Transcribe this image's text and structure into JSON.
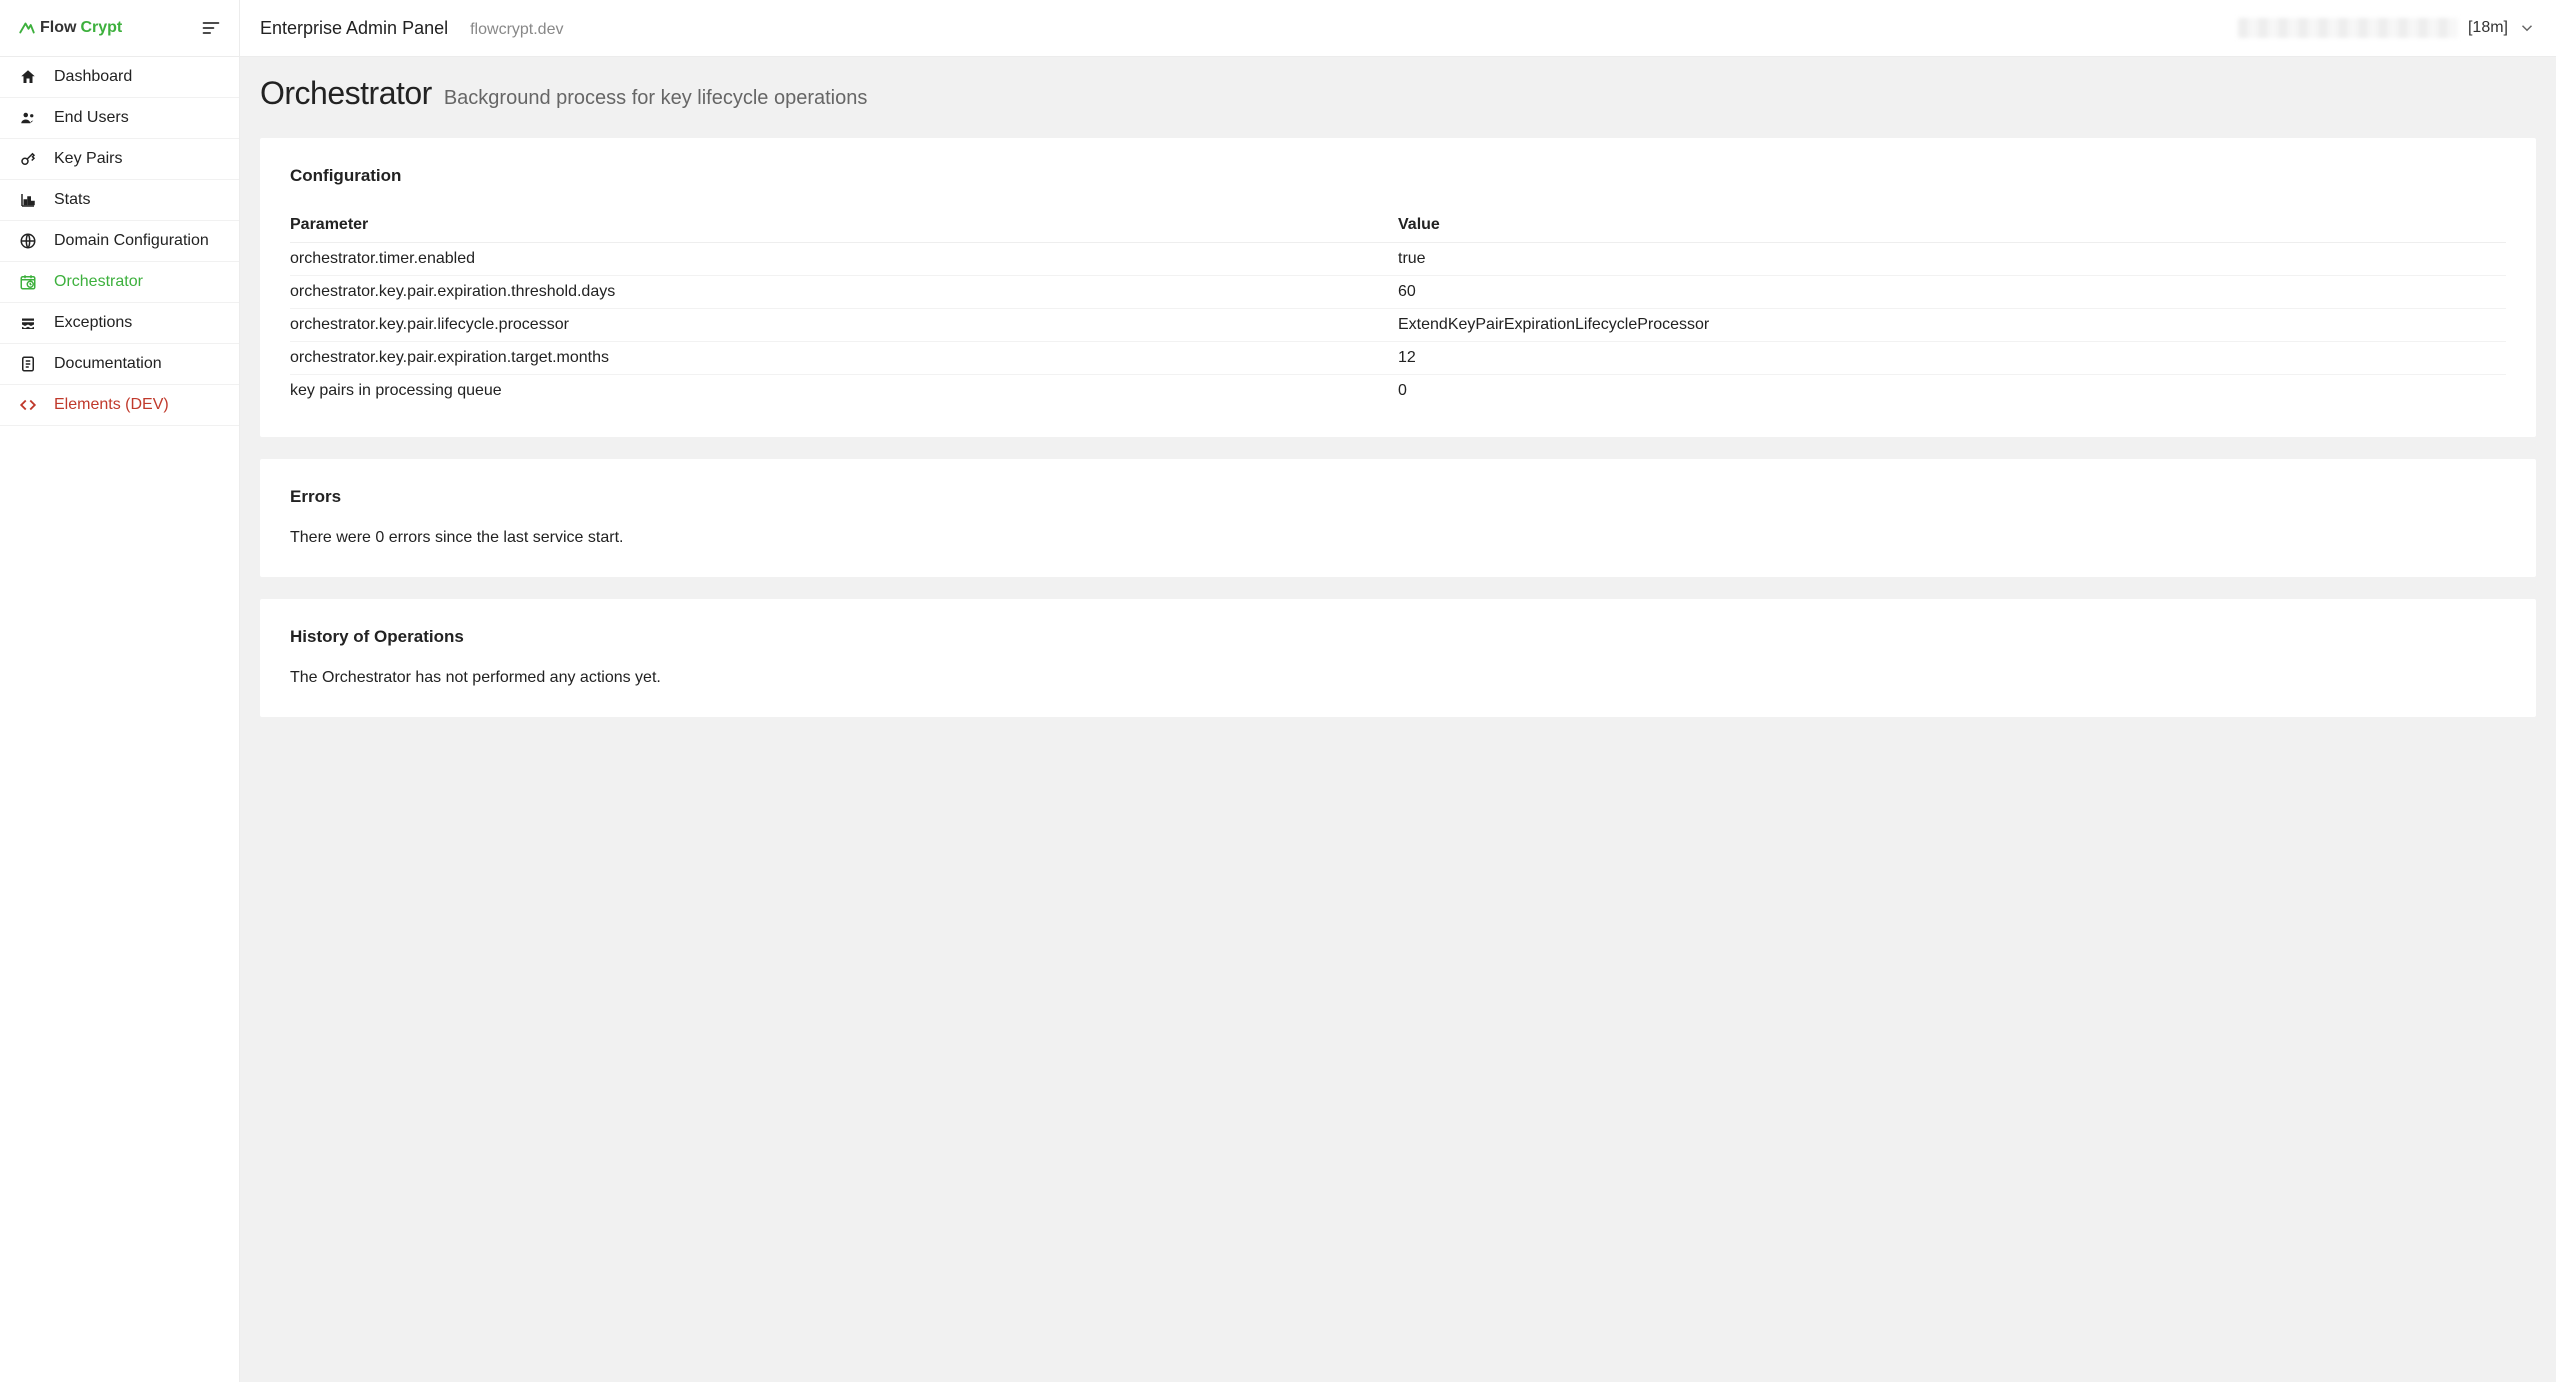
{
  "brand": {
    "flow": "Flow",
    "crypt": "Crypt"
  },
  "sidebar": {
    "items": [
      {
        "label": "Dashboard"
      },
      {
        "label": "End Users"
      },
      {
        "label": "Key Pairs"
      },
      {
        "label": "Stats"
      },
      {
        "label": "Domain Configuration"
      },
      {
        "label": "Orchestrator"
      },
      {
        "label": "Exceptions"
      },
      {
        "label": "Documentation"
      },
      {
        "label": "Elements (DEV)"
      }
    ]
  },
  "topbar": {
    "title": "Enterprise Admin Panel",
    "domain": "flowcrypt.dev",
    "session": "[18m]"
  },
  "page": {
    "title": "Orchestrator",
    "subtitle": "Background process for key lifecycle operations"
  },
  "config": {
    "title": "Configuration",
    "headers": {
      "param": "Parameter",
      "value": "Value"
    },
    "rows": [
      {
        "param": "orchestrator.timer.enabled",
        "value": "true"
      },
      {
        "param": "orchestrator.key.pair.expiration.threshold.days",
        "value": "60"
      },
      {
        "param": "orchestrator.key.pair.lifecycle.processor",
        "value": "ExtendKeyPairExpirationLifecycleProcessor"
      },
      {
        "param": "orchestrator.key.pair.expiration.target.months",
        "value": "12"
      },
      {
        "param": "key pairs in processing queue",
        "value": "0"
      }
    ]
  },
  "errors": {
    "title": "Errors",
    "body": "There were 0 errors since the last service start."
  },
  "history": {
    "title": "History of Operations",
    "body": "The Orchestrator has not performed any actions yet."
  }
}
